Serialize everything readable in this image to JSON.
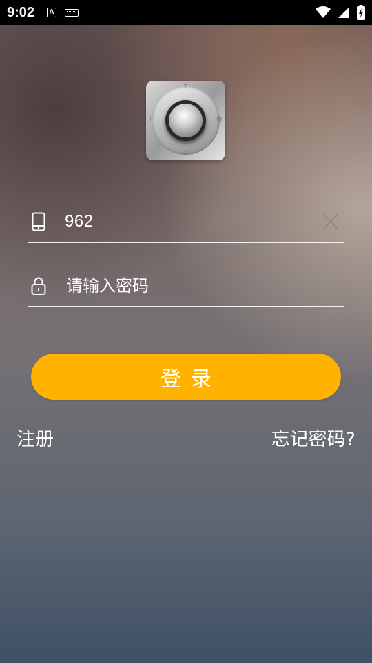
{
  "status_bar": {
    "time": "9:02",
    "icons": [
      "a-notification-icon",
      "keyboard-icon",
      "wifi-icon",
      "signal-icon",
      "battery-charging-icon"
    ]
  },
  "logo": {
    "icon": "safe-knob-icon"
  },
  "phone_field": {
    "icon": "phone-icon",
    "value": "962",
    "clear_icon": "close-icon"
  },
  "password_field": {
    "icon": "lock-icon",
    "placeholder": "请输入密码"
  },
  "login_button": {
    "label": "登录"
  },
  "register_link": {
    "label": "注册"
  },
  "forgot_link": {
    "label": "忘记密码?"
  },
  "colors": {
    "accent": "#ffb300",
    "text": "#ffffff"
  }
}
